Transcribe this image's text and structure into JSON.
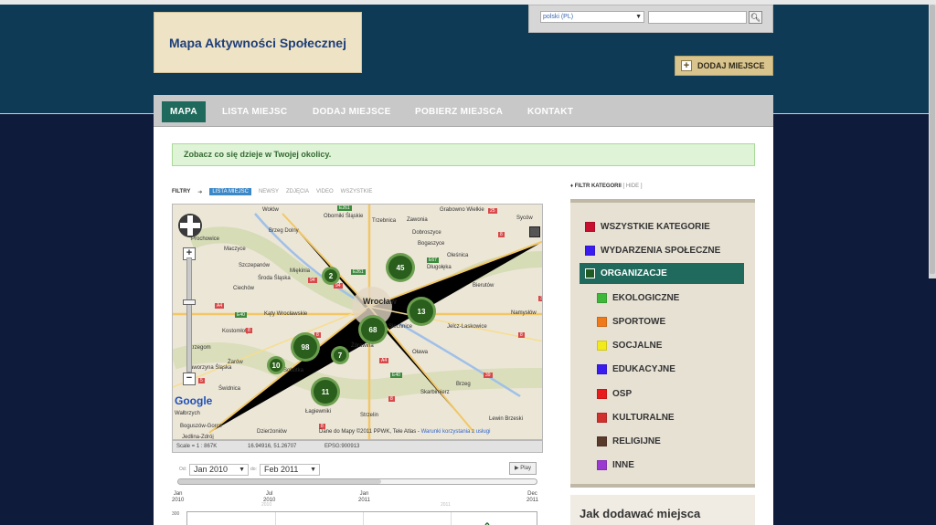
{
  "site": {
    "title": "Mapa Aktywności Społecznej"
  },
  "lang": {
    "selected": "polski (PL)"
  },
  "search": {
    "placeholder": "",
    "button_icon": "search-icon"
  },
  "header": {
    "add_place": "DODAJ MIEJSCE"
  },
  "nav": {
    "items": [
      {
        "label": "MAPA",
        "active": true
      },
      {
        "label": "LISTA MIEJSC"
      },
      {
        "label": "DODAJ MIEJSCE"
      },
      {
        "label": "POBIERZ MIEJSCA"
      },
      {
        "label": "KONTAKT"
      }
    ]
  },
  "notice": "Zobacz co się dzieje w Twojej okolicy.",
  "filters": {
    "label": "FILTRY",
    "arrow": "➔",
    "tabs": [
      "LISTA MIEJSC",
      "NEWSY",
      "ZDJĘCIA",
      "VIDEO",
      "WSZYSTKIE"
    ]
  },
  "map": {
    "city": "Wrocław",
    "towns": [
      "Wołów",
      "Oborniki Śląskie",
      "Trzebnica",
      "Grabowno Wielkie",
      "Syców",
      "Prochowice",
      "Brzeg Dolny",
      "Zawonia",
      "Dobroszyce",
      "Maczyce",
      "Bogaszyce",
      "Oleśnica",
      "Szczepanów",
      "Miękinia",
      "Długołęka",
      "Bierutów",
      "Środa Śląska",
      "Ciechów",
      "Kąty Wrocławskie",
      "Siechnice",
      "Jelcz-Laskowice",
      "Namysłów",
      "Kostomłoty",
      "Żórawina",
      "Oława",
      "Strzegom",
      "Żarów",
      "Jaworzyna Śląska",
      "Sobótka",
      "Brzeg",
      "Świdnica",
      "Skarbimierz",
      "Wałbrzych",
      "Strzelin",
      "Łagiewniki",
      "Lewin Brzeski",
      "Dzierżoniów",
      "Jedlina-Zdrój",
      "Boguszów-Gorce"
    ],
    "clusters": [
      {
        "count": "45"
      },
      {
        "count": "2"
      },
      {
        "count": "13"
      },
      {
        "count": "68"
      },
      {
        "count": "98"
      },
      {
        "count": "7"
      },
      {
        "count": "10"
      },
      {
        "count": "11"
      }
    ],
    "credit": "Dane do Mapy ©2011 PPWK, Tele Atlas - ",
    "credit_link": "Warunki korzystania z usługi",
    "google": "Google"
  },
  "map_footer": {
    "scale": "Scale = 1 : 867K",
    "coords": "16.94916, 51.26707",
    "epsg": "EPSG:900913"
  },
  "timeline": {
    "from_label": "Od:",
    "from": "Jan 2010",
    "to_label": "do:",
    "to": "Feb 2011",
    "play": "▶ Play",
    "ticks": [
      {
        "m": "Jan",
        "y": "2010"
      },
      {
        "m": "Jul",
        "y": "2010"
      },
      {
        "m": "Jan",
        "y": "2011"
      },
      {
        "m": "Dec",
        "y": "2011"
      }
    ],
    "ghost_years": [
      "2010",
      "2011"
    ],
    "y_max": "300"
  },
  "category_filter": {
    "title": "FILTR KATEGORII",
    "hide": "[ HIDE ]",
    "items": [
      {
        "label": "WSZYSTKIE KATEGORIE",
        "color": "#c8102e"
      },
      {
        "label": "WYDARZENIA SPOŁECZNE",
        "color": "#3a1cf0"
      },
      {
        "label": "ORGANIZACJE",
        "color": "#1f5a22",
        "selected": true
      },
      {
        "label": "EKOLOGICZNE",
        "color": "#3fb83a"
      },
      {
        "label": "SPORTOWE",
        "color": "#f07a1a"
      },
      {
        "label": "SOCJALNE",
        "color": "#f2ea1a"
      },
      {
        "label": "EDUKACYJNE",
        "color": "#3a1cf0"
      },
      {
        "label": "OSP",
        "color": "#e81c1c"
      },
      {
        "label": "KULTURALNE",
        "color": "#d0312d"
      },
      {
        "label": "RELIGIJNE",
        "color": "#5a3a2a"
      },
      {
        "label": "INNE",
        "color": "#9a3ad0"
      }
    ]
  },
  "howto": {
    "title": "Jak dodawać miejsca"
  }
}
